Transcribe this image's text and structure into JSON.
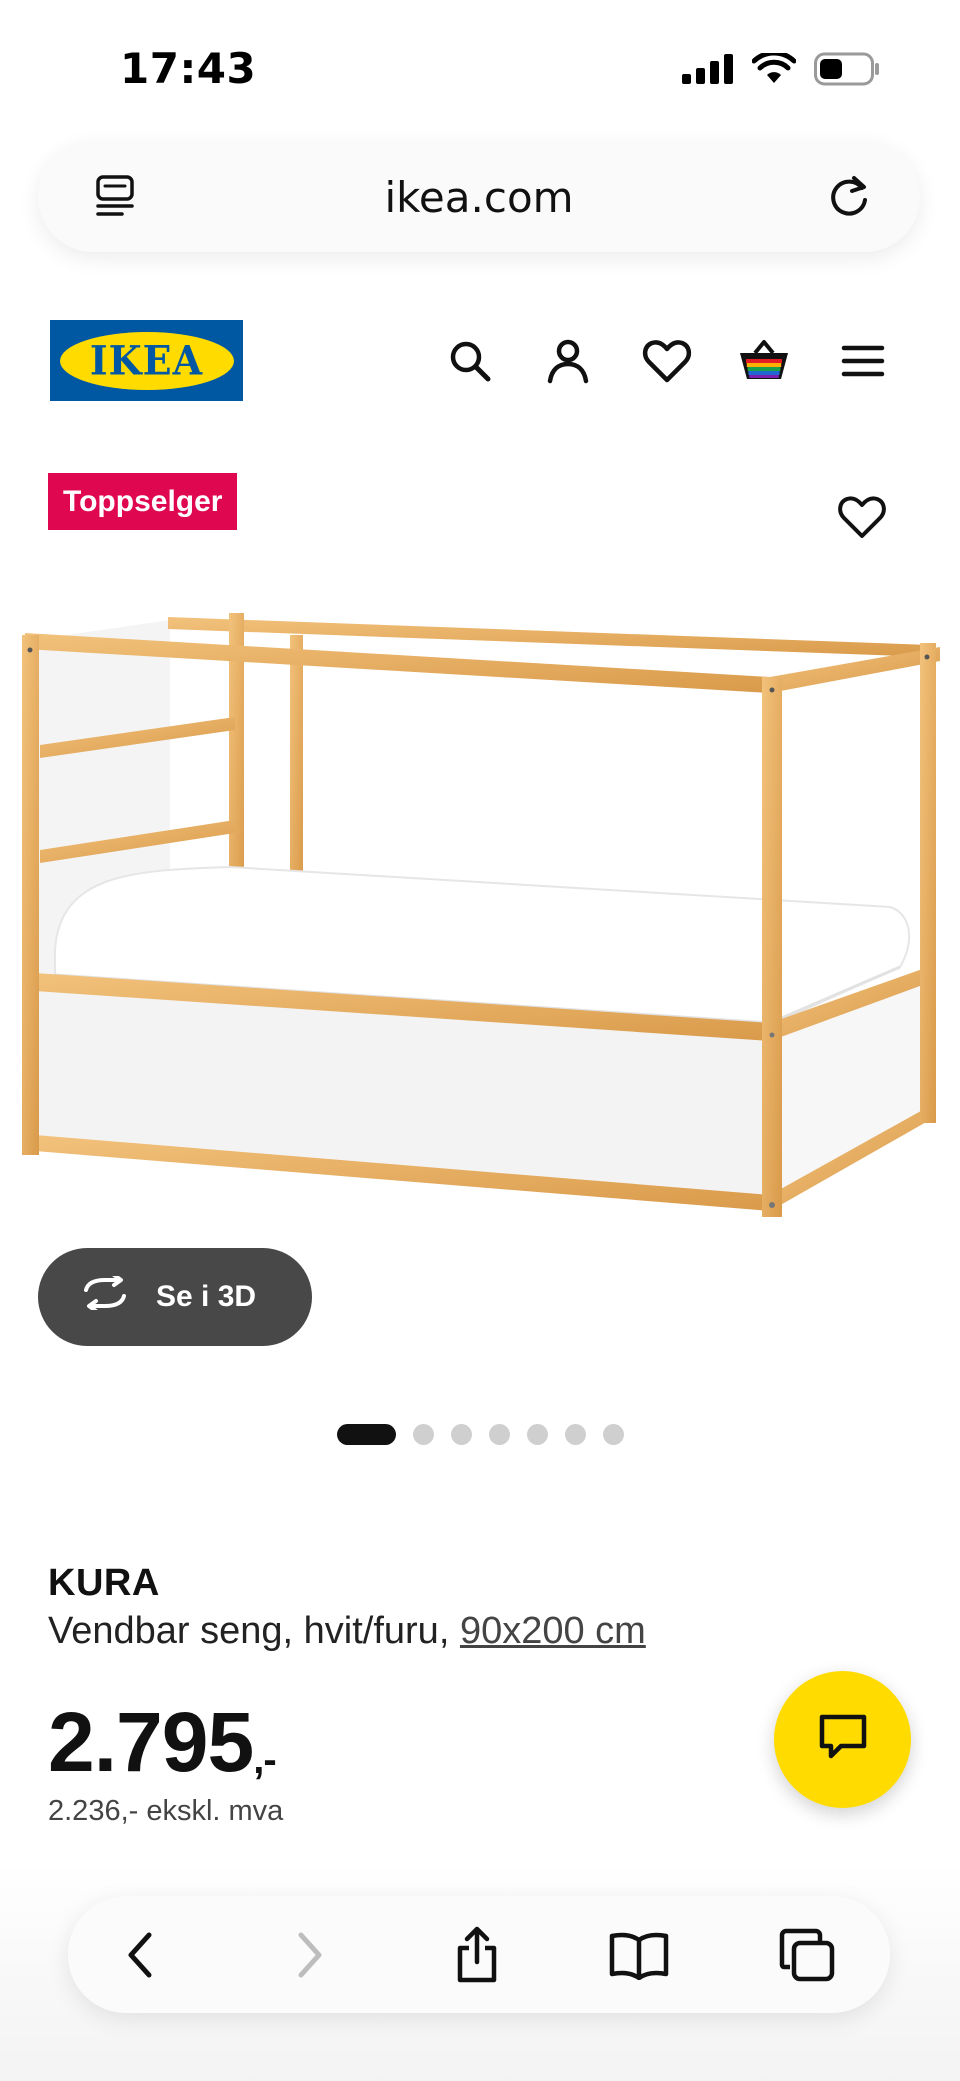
{
  "status_bar": {
    "time": "17:43",
    "icons": [
      "signal-icon",
      "wifi-icon",
      "battery-icon"
    ]
  },
  "browser": {
    "url": "ikea.com",
    "icons": [
      "reader-icon",
      "reload-icon"
    ]
  },
  "site_header": {
    "logo_text": "IKEA",
    "icons": [
      "search-icon",
      "account-icon",
      "heart-icon",
      "basket-icon",
      "menu-icon"
    ]
  },
  "product": {
    "badge": "Toppselger",
    "image_alt": "KURA bed",
    "view_3d_label": "Se i 3D",
    "carousel": {
      "total": 7,
      "active": 1
    },
    "name": "KURA",
    "description": "Vendbar seng, hvit/furu, ",
    "size": "90x200 cm",
    "price": "2.795",
    "price_suffix": ",-",
    "price_ex_vat": "2.236,- ekskl. mva"
  },
  "colors": {
    "ikea_blue": "#0058a3",
    "ikea_yellow": "#ffdb00",
    "badge_red": "#e00751",
    "button_dark": "#484848"
  },
  "bottom_toolbar": {
    "icons": [
      "back-icon",
      "forward-icon",
      "share-icon",
      "bookmarks-icon",
      "tabs-icon"
    ]
  }
}
